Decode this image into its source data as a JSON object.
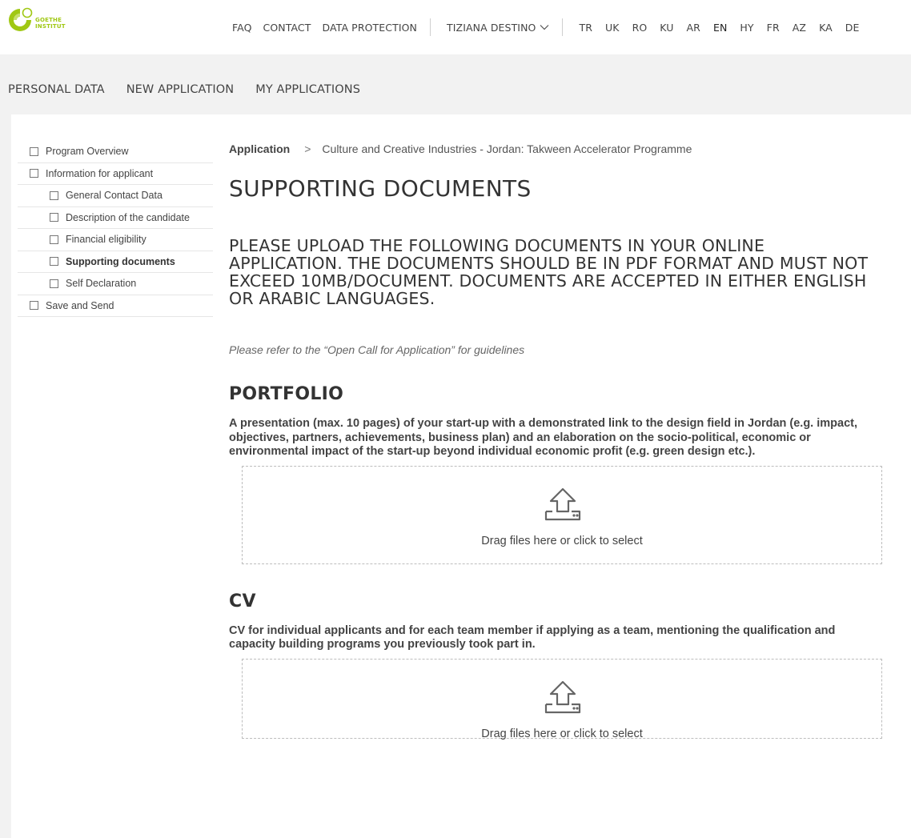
{
  "header": {
    "logo_text_line1": "GOETHE",
    "logo_text_line2": "INSTITUT",
    "nav": {
      "faq": "FAQ",
      "contact": "CONTACT",
      "data_protection": "DATA PROTECTION",
      "user": "TIZIANA DESTINO"
    },
    "languages": [
      "TR",
      "UK",
      "RO",
      "KU",
      "AR",
      "EN",
      "HY",
      "FR",
      "AZ",
      "KA",
      "DE"
    ],
    "active_language": "EN"
  },
  "main_nav": {
    "personal_data": "PERSONAL DATA",
    "new_application": "NEW APPLICATION",
    "my_applications": "MY APPLICATIONS"
  },
  "sidebar": {
    "items": [
      {
        "label": "Program Overview"
      },
      {
        "label": "Information for applicant"
      },
      {
        "label": "General Contact Data"
      },
      {
        "label": "Description of the candidate"
      },
      {
        "label": "Financial eligibility"
      },
      {
        "label": "Supporting documents"
      },
      {
        "label": "Self Declaration"
      },
      {
        "label": "Save and Send"
      }
    ]
  },
  "breadcrumb": {
    "root": "Application",
    "current": "Culture and Creative Industries - Jordan: Takween Accelerator Programme"
  },
  "page": {
    "title": "SUPPORTING DOCUMENTS",
    "intro": "PLEASE UPLOAD THE FOLLOWING DOCUMENTS IN YOUR ONLINE APPLICATION. THE DOCUMENTS SHOULD BE IN PDF FORMAT AND MUST NOT EXCEED 10MB/DOCUMENT. DOCUMENTS ARE ACCEPTED IN EITHER ENGLISH OR ARABIC LANGUAGES.",
    "note": "Please refer to the “Open Call for Application” for guidelines"
  },
  "sections": {
    "portfolio": {
      "title": "PORTFOLIO",
      "description": "A presentation (max. 10 pages) of your start-up with a demonstrated link to the design field in Jordan (e.g. impact, objectives, partners, achievements, business plan) and an elaboration on the socio-political, economic or environmental impact of the start-up beyond individual economic profit (e.g. green design etc.).",
      "dropzone": "Drag files here or click to select"
    },
    "cv": {
      "title": "CV",
      "description": "CV for individual applicants and for each team member if applying as a team, mentioning the qualification and capacity building programs you previously took part in.",
      "dropzone": "Drag files here or click to select"
    }
  },
  "colors": {
    "brand_green": "#a0c814",
    "band_gray": "#f2f2f2"
  }
}
